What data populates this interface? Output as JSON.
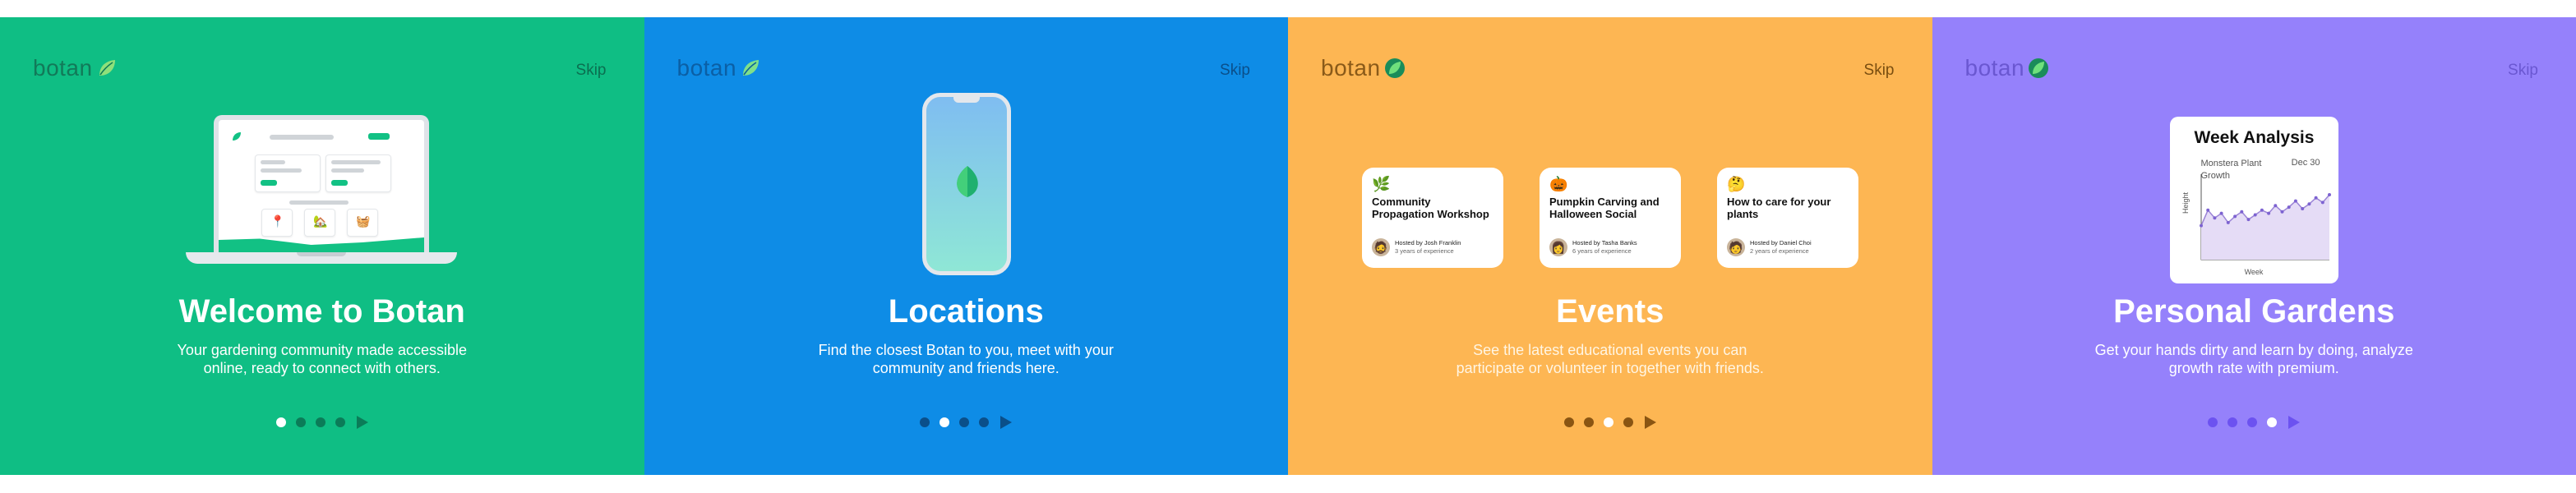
{
  "brand": {
    "name": "botan"
  },
  "skip_label": "Skip",
  "panels": [
    {
      "title": "Welcome to Botan",
      "description": "Your gardening community made accessible online, ready to connect with others.",
      "active_dot": 1,
      "background": "#0FBE84"
    },
    {
      "title": "Locations",
      "description": "Find the closest Botan to you, meet with your community and friends here.",
      "active_dot": 2,
      "background": "#0E8CE6"
    },
    {
      "title": "Events",
      "description": "See the latest educational events you can participate or volunteer in together with friends.",
      "active_dot": 3,
      "background": "#FDB653",
      "events": [
        {
          "emoji": "🌿",
          "title": "Community Propagation Workshop",
          "host": "Hosted by Josh Franklin",
          "experience": "3 years of experience",
          "avatar": "🧔"
        },
        {
          "emoji": "🎃",
          "title": "Pumpkin Carving and Halloween Social",
          "host": "Hosted by Tasha Banks",
          "experience": "6 years of experience",
          "avatar": "👩"
        },
        {
          "emoji": "🤔",
          "title": "How to care for your plants",
          "host": "Hosted by Daniel Choi",
          "experience": "2 years of experience",
          "avatar": "🧑"
        }
      ]
    },
    {
      "title": "Personal Gardens",
      "description": "Get your hands dirty and learn by doing, analyze growth rate with premium.",
      "active_dot": 4,
      "background": "#9581FB",
      "week_analysis": {
        "title": "Week Analysis",
        "plant": "Monstera Plant Growth",
        "date": "Dec 30",
        "ylabel": "Height",
        "xlabel": "Week"
      }
    }
  ],
  "chart_data": {
    "type": "area",
    "title": "Week Analysis",
    "xlabel": "Week",
    "ylabel": "Height",
    "values": [
      2.2,
      3.2,
      2.7,
      3.0,
      2.4,
      2.8,
      3.1,
      2.6,
      2.9,
      3.2,
      3.0,
      3.5,
      3.1,
      3.4,
      3.8,
      3.3,
      3.6,
      4.0,
      3.7,
      4.2
    ]
  },
  "colors": {
    "green": "#0FBE84",
    "blue": "#0E8CE6",
    "orange": "#FDB653",
    "purple": "#9581FB",
    "chart_fill": "#e5dcf6",
    "chart_line": "#9b84d6"
  },
  "icons": [
    "leaf-logo-icon",
    "pin-icon",
    "house-icon",
    "watering-icon",
    "play-icon"
  ]
}
